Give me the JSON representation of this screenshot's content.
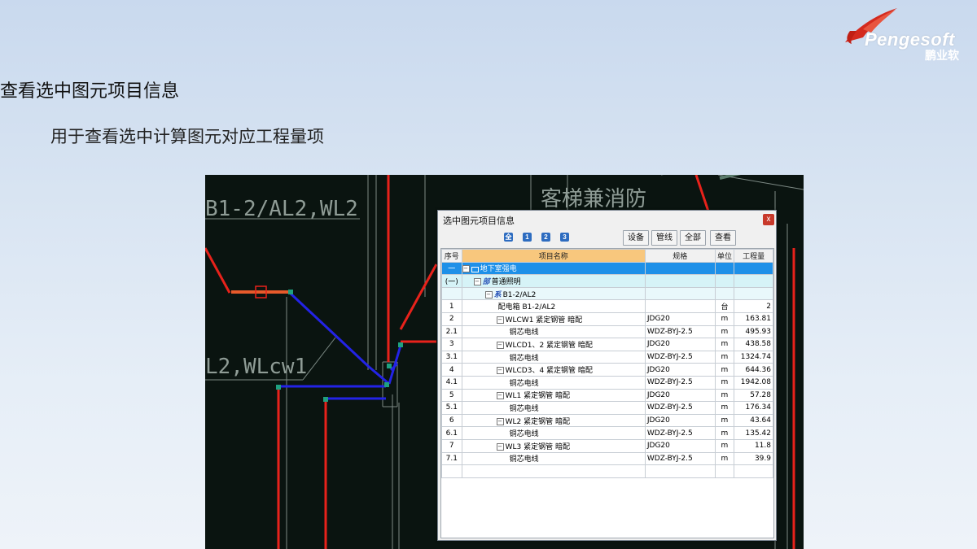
{
  "slide": {
    "title": "查看选中图元项目信息",
    "subtitle": "用于查看选中计算图元对应工程量项"
  },
  "logo": {
    "wordmark": "Pengesoft",
    "chinese": "鹏业软"
  },
  "cad": {
    "labels": [
      "B1-2/AL2,WL2",
      "L2,WLcw1",
      "客梯兼消防"
    ]
  },
  "dialog": {
    "title": "选中图元项目信息",
    "close": "x",
    "levels": [
      "全",
      "1",
      "2",
      "3"
    ],
    "buttons": [
      "设备",
      "管线",
      "全部",
      "查看"
    ],
    "columns": [
      "序号",
      "项目名称",
      "规格",
      "单位",
      "工程量"
    ],
    "rows": [
      {
        "no": "一",
        "name": "地下室强电",
        "spec": "",
        "unit": "",
        "qty": ""
      },
      {
        "no": "(一)",
        "tag": "部",
        "name": "普通照明",
        "spec": "",
        "unit": "",
        "qty": ""
      },
      {
        "no": "",
        "tag": "系",
        "name": "B1-2/AL2",
        "spec": "",
        "unit": "",
        "qty": ""
      },
      {
        "no": "1",
        "name": "配电箱 B1-2/AL2",
        "spec": "",
        "unit": "台",
        "qty": "2"
      },
      {
        "no": "2",
        "name": "WLCW1 紧定钢管 暗配",
        "spec": "JDG20",
        "unit": "m",
        "qty": "163.81"
      },
      {
        "no": "2.1",
        "name": "铜芯电线",
        "spec": "WDZ-BYJ-2.5",
        "unit": "m",
        "qty": "495.93"
      },
      {
        "no": "3",
        "name": "WLCD1、2 紧定钢管 暗配",
        "spec": "JDG20",
        "unit": "m",
        "qty": "438.58"
      },
      {
        "no": "3.1",
        "name": "铜芯电线",
        "spec": "WDZ-BYJ-2.5",
        "unit": "m",
        "qty": "1324.74"
      },
      {
        "no": "4",
        "name": "WLCD3、4 紧定钢管 暗配",
        "spec": "JDG20",
        "unit": "m",
        "qty": "644.36"
      },
      {
        "no": "4.1",
        "name": "铜芯电线",
        "spec": "WDZ-BYJ-2.5",
        "unit": "m",
        "qty": "1942.08"
      },
      {
        "no": "5",
        "name": "WL1 紧定钢管 暗配",
        "spec": "JDG20",
        "unit": "m",
        "qty": "57.28"
      },
      {
        "no": "5.1",
        "name": "铜芯电线",
        "spec": "WDZ-BYJ-2.5",
        "unit": "m",
        "qty": "176.34"
      },
      {
        "no": "6",
        "name": "WL2 紧定钢管 暗配",
        "spec": "JDG20",
        "unit": "m",
        "qty": "43.64"
      },
      {
        "no": "6.1",
        "name": "铜芯电线",
        "spec": "WDZ-BYJ-2.5",
        "unit": "m",
        "qty": "135.42"
      },
      {
        "no": "7",
        "name": "WL3 紧定钢管 暗配",
        "spec": "JDG20",
        "unit": "m",
        "qty": "11.8"
      },
      {
        "no": "7.1",
        "name": "铜芯电线",
        "spec": "WDZ-BYJ-2.5",
        "unit": "m",
        "qty": "39.9"
      }
    ]
  },
  "colors": {
    "selected_row": "#1e90e8",
    "header_highlight": "#f8c77d",
    "cad_background": "#0a1410",
    "cad_red": "#e8221b",
    "cad_blue": "#2020e0"
  }
}
